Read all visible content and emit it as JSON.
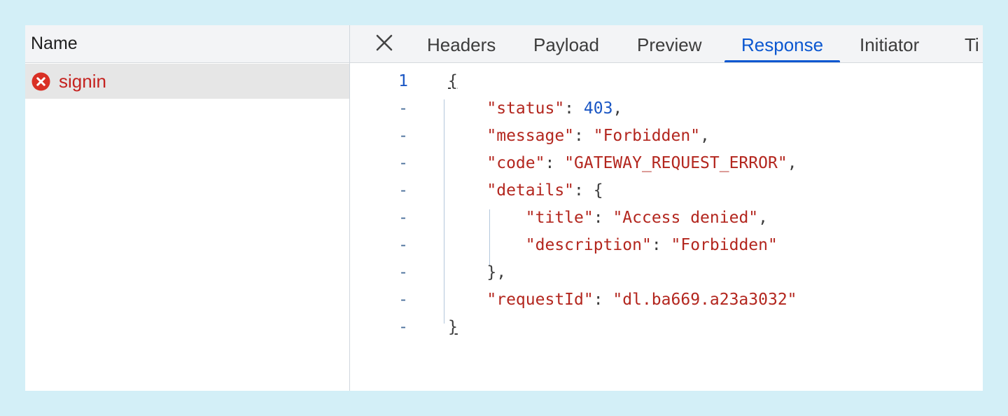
{
  "request_list": {
    "header": "Name",
    "requests": [
      {
        "name": "signin",
        "status": "error"
      }
    ]
  },
  "tabs": [
    "Headers",
    "Payload",
    "Preview",
    "Response",
    "Initiator",
    "Ti"
  ],
  "active_tab": "Response",
  "response": {
    "first_line_number": "1",
    "fold_marker": "-",
    "lines": [
      {
        "indent": 0,
        "text": "{"
      },
      {
        "indent": 1,
        "key": "\"status\"",
        "value": "403",
        "value_type": "number",
        "trail": ","
      },
      {
        "indent": 1,
        "key": "\"message\"",
        "value": "\"Forbidden\"",
        "value_type": "string",
        "trail": ","
      },
      {
        "indent": 1,
        "key": "\"code\"",
        "value": "\"GATEWAY_REQUEST_ERROR\"",
        "value_type": "string",
        "trail": ","
      },
      {
        "indent": 1,
        "key": "\"details\"",
        "value": "{",
        "value_type": "punct",
        "trail": ""
      },
      {
        "indent": 2,
        "key": "\"title\"",
        "value": "\"Access denied\"",
        "value_type": "string",
        "trail": ","
      },
      {
        "indent": 2,
        "key": "\"description\"",
        "value": "\"Forbidden\"",
        "value_type": "string",
        "trail": ""
      },
      {
        "indent": 1,
        "text": "},"
      },
      {
        "indent": 1,
        "key": "\"requestId\"",
        "value": "\"dl.ba669.a23a3032\"",
        "value_type": "string",
        "trail": ""
      },
      {
        "indent": 0,
        "text": "}"
      }
    ]
  },
  "colors": {
    "background": "#d3eff7",
    "accent": "#0b57d0",
    "error": "#c5221f",
    "json_string": "#b3261e",
    "json_number": "#1a56c4"
  },
  "icons": {
    "request_status": "error-circle-icon",
    "close": "close-icon"
  }
}
